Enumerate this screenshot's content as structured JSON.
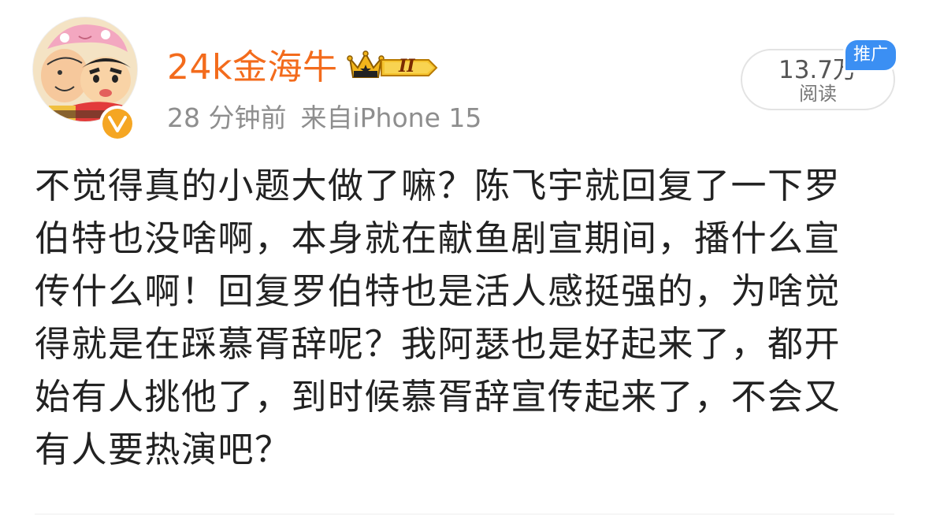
{
  "post": {
    "author": {
      "name": "24k金海牛",
      "avatar_icon": "cartoon-avatar-icon",
      "verified_icon": "verified-v-icon",
      "member_badge_icon": "crown-level-badge-icon",
      "member_badge_text": "II"
    },
    "meta": {
      "time": "28 分钟前",
      "source": "来自iPhone 15"
    },
    "stats": {
      "read_count": "13.7万",
      "read_label": "阅读",
      "promo_tag": "推广"
    },
    "content_lines": [
      "不觉得真的小题大做了嘛？陈飞宇就回复了一下罗",
      "伯特也没啥啊，本身就在献鱼剧宣期间，播什么宣",
      "传什么啊！回复罗伯特也是活人感挺强的，为啥觉",
      "得就是在踩慕胥辞呢？我阿瑟也是好起来了，都开",
      "始有人挑他了，到时候慕胥辞宣传起来了，不会又",
      "有人要热演吧？"
    ]
  },
  "colors": {
    "username": "#f36b1c",
    "meta_text": "#8e8e8e",
    "body_text": "#222222",
    "promo_bg": "#3b8ff3",
    "verified": "#f5a623"
  }
}
